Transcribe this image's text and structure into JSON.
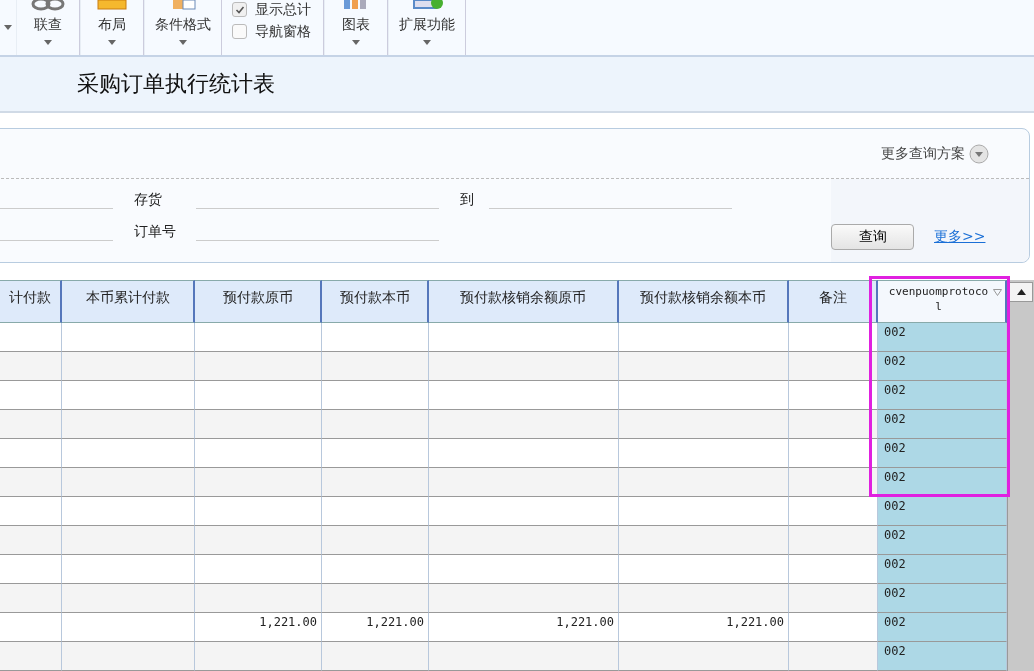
{
  "toolbar": [
    {
      "kind": "button",
      "label": "联查"
    },
    {
      "kind": "button",
      "label": "布局"
    },
    {
      "kind": "button",
      "label": "条件格式"
    },
    {
      "kind": "checks",
      "items": [
        {
          "label": "显示总计",
          "checked": true
        },
        {
          "label": "导航窗格",
          "checked": false
        }
      ]
    },
    {
      "kind": "button",
      "label": "图表"
    },
    {
      "kind": "button",
      "label": "扩展功能"
    }
  ],
  "report_title": "采购订单执行统计表",
  "query": {
    "more_schemes": "更多查询方案",
    "fields": [
      {
        "label": "存货",
        "range_label": "到"
      },
      {
        "label": "订单号"
      }
    ],
    "query_button": "查询",
    "more_link": "更多>>"
  },
  "table": {
    "columns": [
      {
        "label": "计付款",
        "selected": false
      },
      {
        "label": "本币累计付款",
        "selected": false
      },
      {
        "label": "预付款原币",
        "selected": false
      },
      {
        "label": "预付款本币",
        "selected": false
      },
      {
        "label": "预付款核销余额原币",
        "selected": false
      },
      {
        "label": "预付款核销余额本币",
        "selected": false
      },
      {
        "label": "备注",
        "selected": false
      },
      {
        "label": "cvenpuomprotocol",
        "selected": true
      }
    ],
    "rows": [
      {
        "cells": [
          null,
          null,
          null,
          null,
          null,
          null,
          null,
          "002"
        ]
      },
      {
        "cells": [
          null,
          null,
          null,
          null,
          null,
          null,
          null,
          "002"
        ]
      },
      {
        "cells": [
          null,
          null,
          null,
          null,
          null,
          null,
          null,
          "002"
        ]
      },
      {
        "cells": [
          null,
          null,
          null,
          null,
          null,
          null,
          null,
          "002"
        ]
      },
      {
        "cells": [
          null,
          null,
          null,
          null,
          null,
          null,
          null,
          "002"
        ]
      },
      {
        "cells": [
          null,
          null,
          null,
          null,
          null,
          null,
          null,
          "002"
        ]
      },
      {
        "cells": [
          null,
          null,
          null,
          null,
          null,
          null,
          null,
          "002"
        ]
      },
      {
        "cells": [
          null,
          null,
          null,
          null,
          null,
          null,
          null,
          "002"
        ]
      },
      {
        "cells": [
          null,
          null,
          null,
          null,
          null,
          null,
          null,
          "002"
        ]
      },
      {
        "cells": [
          null,
          null,
          null,
          null,
          null,
          null,
          null,
          "002"
        ]
      },
      {
        "cells": [
          null,
          null,
          "1,221.00",
          "1,221.00",
          "1,221.00",
          "1,221.00",
          null,
          "002"
        ]
      },
      {
        "cells": [
          null,
          null,
          null,
          null,
          null,
          null,
          null,
          "002"
        ]
      }
    ]
  }
}
